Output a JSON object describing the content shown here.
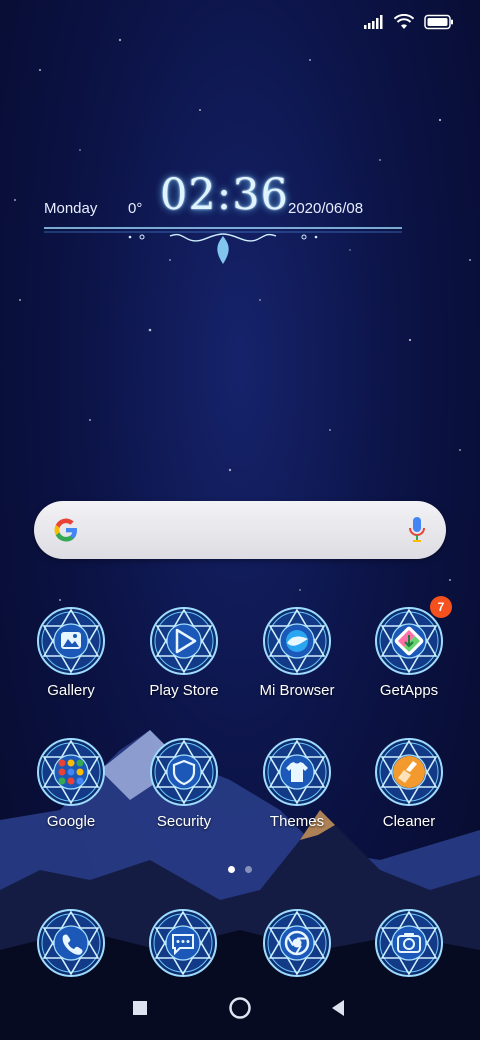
{
  "status_bar": {
    "icons": [
      "signal-icon",
      "wifi-icon",
      "battery-icon"
    ]
  },
  "clock_widget": {
    "day": "Monday",
    "temperature": "0°",
    "time": "02:36",
    "date": "2020/06/08"
  },
  "search": {
    "icons": [
      "google-logo-icon",
      "microphone-icon"
    ]
  },
  "apps": [
    {
      "label": "Gallery",
      "icon": "gallery-icon"
    },
    {
      "label": "Play Store",
      "icon": "play-store-icon"
    },
    {
      "label": "Mi Browser",
      "icon": "browser-icon"
    },
    {
      "label": "GetApps",
      "icon": "getapps-icon",
      "badge": "7"
    },
    {
      "label": "Google",
      "icon": "google-folder-icon"
    },
    {
      "label": "Security",
      "icon": "shield-icon"
    },
    {
      "label": "Themes",
      "icon": "tshirt-icon"
    },
    {
      "label": "Cleaner",
      "icon": "broom-icon"
    }
  ],
  "pager": {
    "pages": 2,
    "active": 0
  },
  "dock": [
    {
      "icon": "phone-icon"
    },
    {
      "icon": "messages-icon"
    },
    {
      "icon": "chrome-icon"
    },
    {
      "icon": "camera-icon"
    }
  ],
  "nav_bar": {
    "buttons": [
      "recents-button",
      "home-button",
      "back-button"
    ]
  },
  "colors": {
    "glow": "#7fd0ff",
    "badge": "#f4511e",
    "background": "#0c1448"
  }
}
